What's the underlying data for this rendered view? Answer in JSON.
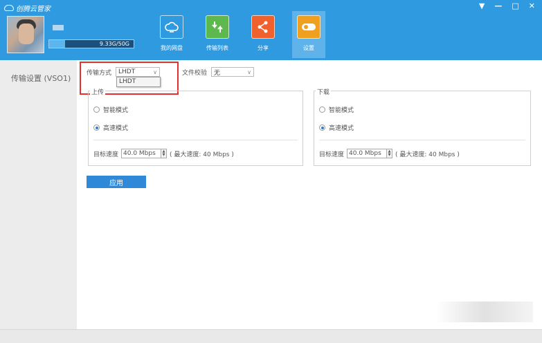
{
  "app": {
    "title": "创腾云管家"
  },
  "window_controls": {
    "menu": "▼",
    "minimize": "—",
    "maximize": "□",
    "close": "✕"
  },
  "account": {
    "quota_text": "9.33G/50G",
    "quota_fraction": 0.19
  },
  "nav": [
    {
      "label": "我的网盘",
      "icon": "cloud-icon",
      "color": "#2f9ae0"
    },
    {
      "label": "传输列表",
      "icon": "transfer-icon",
      "color": "#5db94d"
    },
    {
      "label": "分享",
      "icon": "share-icon",
      "color": "#f0612e"
    },
    {
      "label": "设置",
      "icon": "settings-icon",
      "color": "#f0a020",
      "active": true
    }
  ],
  "sidebar": {
    "items": [
      {
        "label": "传输设置 (VSO1)"
      }
    ]
  },
  "settings": {
    "transfer_mode_label": "传输方式",
    "transfer_mode_value": "LHDT",
    "dropdown_option": "LHDT",
    "verify_label": "文件校验",
    "verify_value": "无"
  },
  "upload": {
    "title": "上传",
    "smart_mode": "智能模式",
    "fast_mode": "高速模式",
    "selected": "fast",
    "target_speed_label": "目标速度",
    "target_speed_value": "40.0 Mbps",
    "max_speed_text": "( 最大速度:  40 Mbps  )"
  },
  "download": {
    "title": "下载",
    "smart_mode": "智能模式",
    "fast_mode": "高速模式",
    "selected": "fast",
    "target_speed_label": "目标速度",
    "target_speed_value": "40.0 Mbps",
    "max_speed_text": "( 最大速度:  40 Mbps  )"
  },
  "apply_label": "应用",
  "colors": {
    "header": "#2f9ae0",
    "accent": "#2f88d8",
    "highlight": "#e62e2e"
  }
}
